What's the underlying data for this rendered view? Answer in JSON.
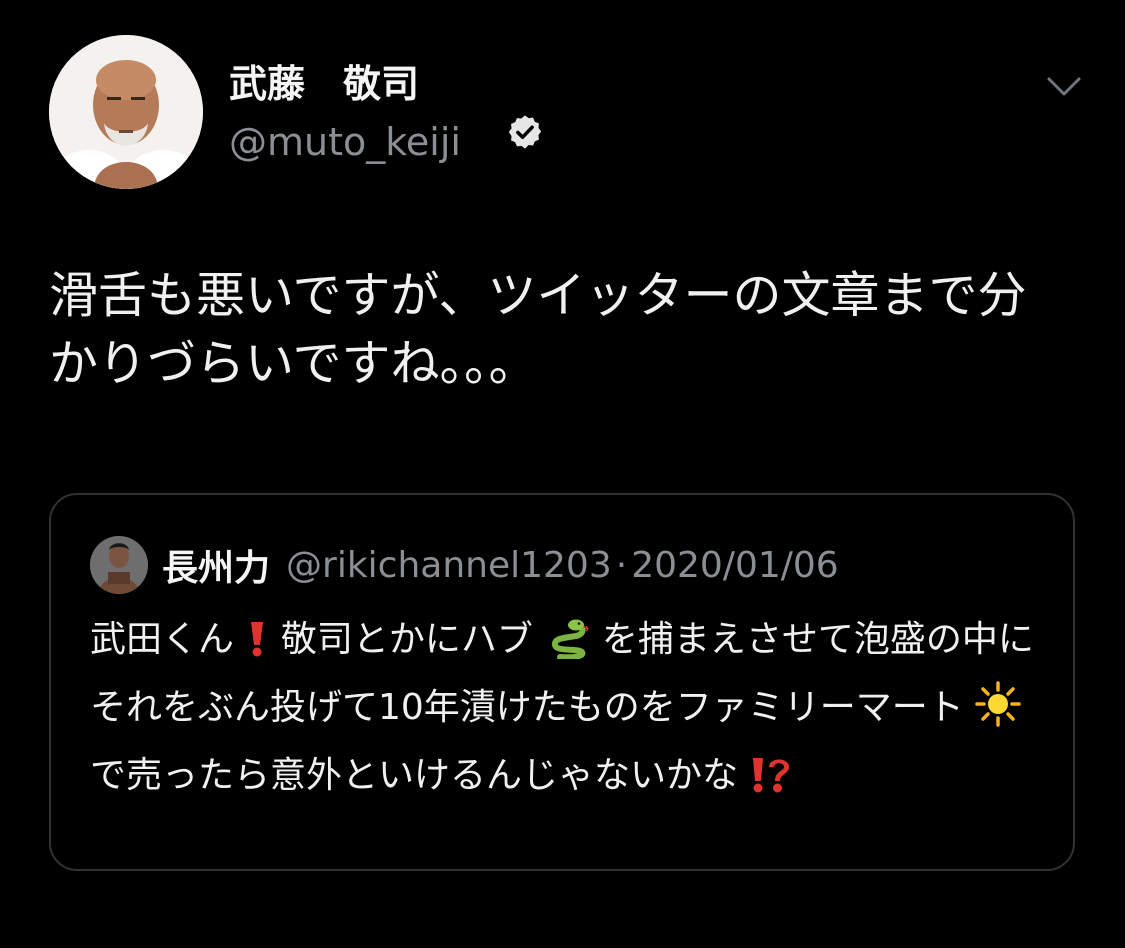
{
  "tweet": {
    "author": {
      "name": "武藤　敬司",
      "handle": "@muto_keiji",
      "verified": true
    },
    "text": "滑舌も悪いですが、ツイッターの文章まで分かりづらいですね。。。",
    "more_icon": "chevron-down-icon"
  },
  "quote": {
    "author": {
      "name": "長州力",
      "handle": "@rikichannel1203",
      "separator": "·",
      "date": "2020/01/06"
    },
    "text_parts": {
      "p1": "武田くん",
      "p2": "敬司とかにハブ",
      "p3": "を捕まえさせて泡盛の中にそれをぶん投げて10年漬けたものをファミリーマート",
      "p4": "で売ったら意外といけるんじゃないかな"
    },
    "emojis": {
      "exclamation": "red-exclamation-emoji",
      "snake": "snake-emoji",
      "sun": "sun-emoji",
      "interrobang": "red-interrobang-emoji"
    }
  },
  "colors": {
    "background": "#000000",
    "text_primary": "#f0f0f0",
    "text_secondary": "#8b8f94",
    "card_border": "#2f3336"
  }
}
